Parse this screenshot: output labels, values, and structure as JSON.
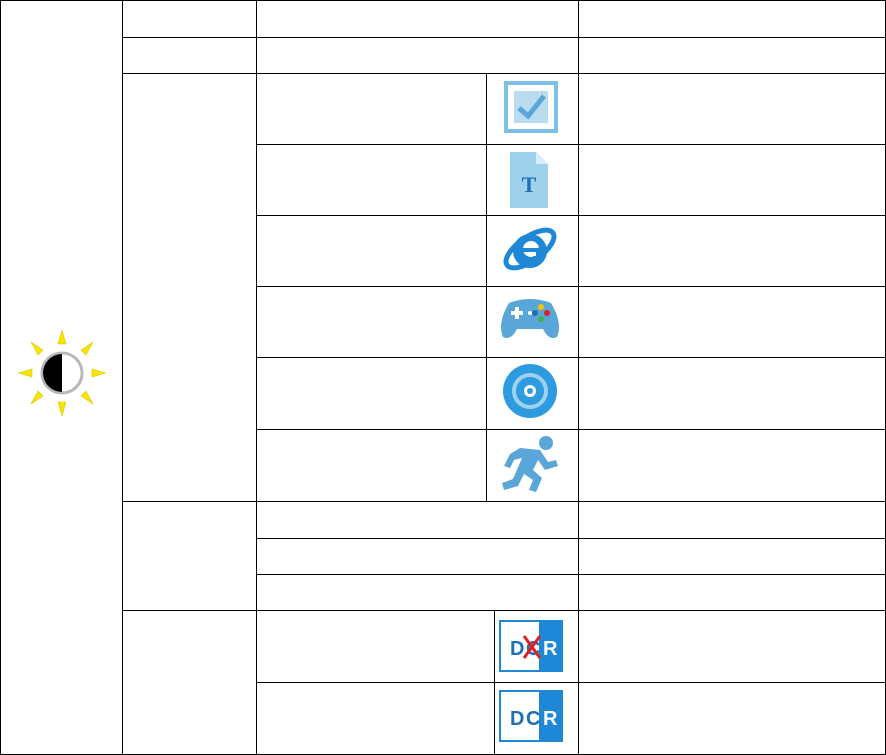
{
  "colors": {
    "border": "#000000",
    "icon_blue": "#1e88d6",
    "icon_light": "#7cc0e8",
    "sun_yellow": "#f5e600",
    "dcr_red": "#e02020"
  },
  "icons": {
    "main": "brightness-contrast-icon",
    "modes": [
      "standard-checkbox-icon",
      "text-document-icon",
      "internet-explorer-icon",
      "game-controller-icon",
      "movie-disc-icon",
      "sports-runner-icon"
    ],
    "dcr": [
      "dcr-off-icon",
      "dcr-on-icon"
    ]
  },
  "dcr_letters": {
    "d": "D",
    "c": "C",
    "r": "R"
  }
}
